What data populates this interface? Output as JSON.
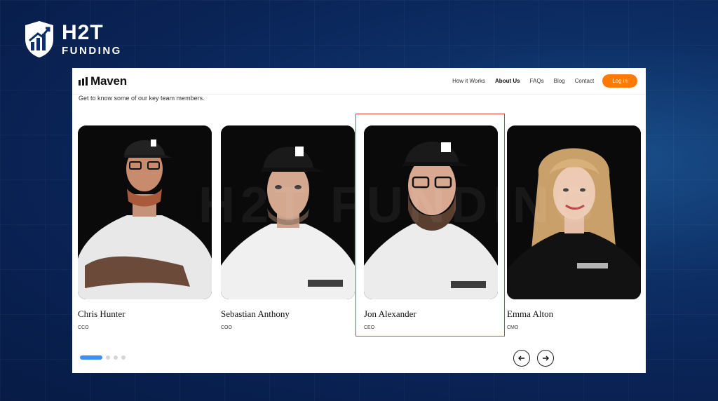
{
  "brand": {
    "name": "H2T",
    "sub": "FUNDING"
  },
  "nav": {
    "logo": "Maven",
    "items": [
      "How it Works",
      "About Us",
      "FAQs",
      "Blog",
      "Contact"
    ],
    "active_index": 1,
    "login_label": "Log in"
  },
  "intro": "Get to know some of our key team members.",
  "watermark": "H2T FUNDING",
  "team": [
    {
      "name": "Chris Hunter",
      "role": "CCO"
    },
    {
      "name": "Sebastian Anthony",
      "role": "COO"
    },
    {
      "name": "Jon Alexander",
      "role": "CEO"
    },
    {
      "name": "Emma Alton",
      "role": "CMO"
    }
  ],
  "pagination": {
    "total": 4,
    "current": 1
  },
  "colors": {
    "accent": "#ff7a00",
    "highlight": "#e03a3a",
    "dot_active": "#3d8ef5"
  }
}
